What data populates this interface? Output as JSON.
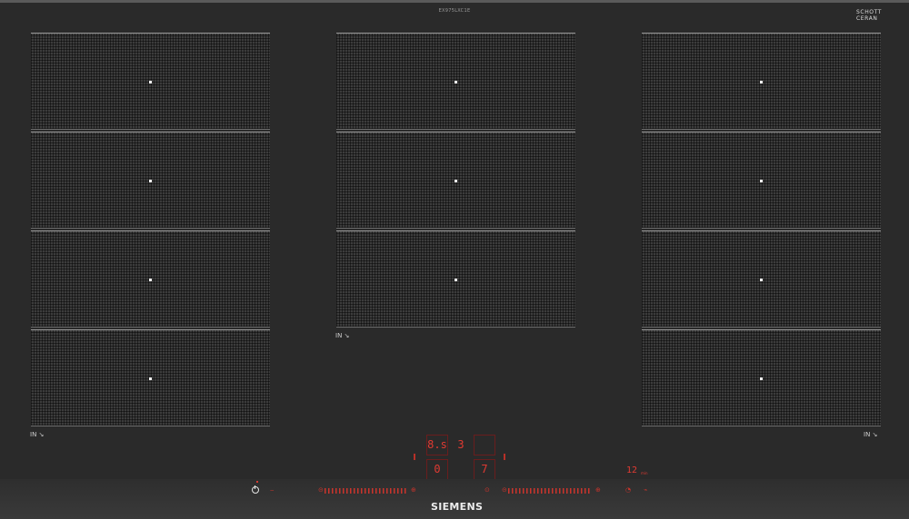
{
  "model_number": "EX975LXC1E",
  "glass_brand": {
    "line1": "SCHOTT",
    "line2": "CERAN",
    "sub": "®"
  },
  "zones": {
    "left": {
      "count": 4,
      "indicator": "IN"
    },
    "center": {
      "count": 3,
      "indicator": "IN"
    },
    "right": {
      "count": 4,
      "indicator": "IN"
    }
  },
  "brand": "SIEMENS",
  "displays": {
    "zone_level_a": "8.s",
    "zone_level_b": "3",
    "zone_level_c": "0",
    "zone_level_d": "7",
    "timer": "12",
    "timer_unit": "min"
  },
  "colors": {
    "glass": "#2a2a2a",
    "display_red": "#e03a32",
    "zone_grid": "#3c3c3c"
  }
}
